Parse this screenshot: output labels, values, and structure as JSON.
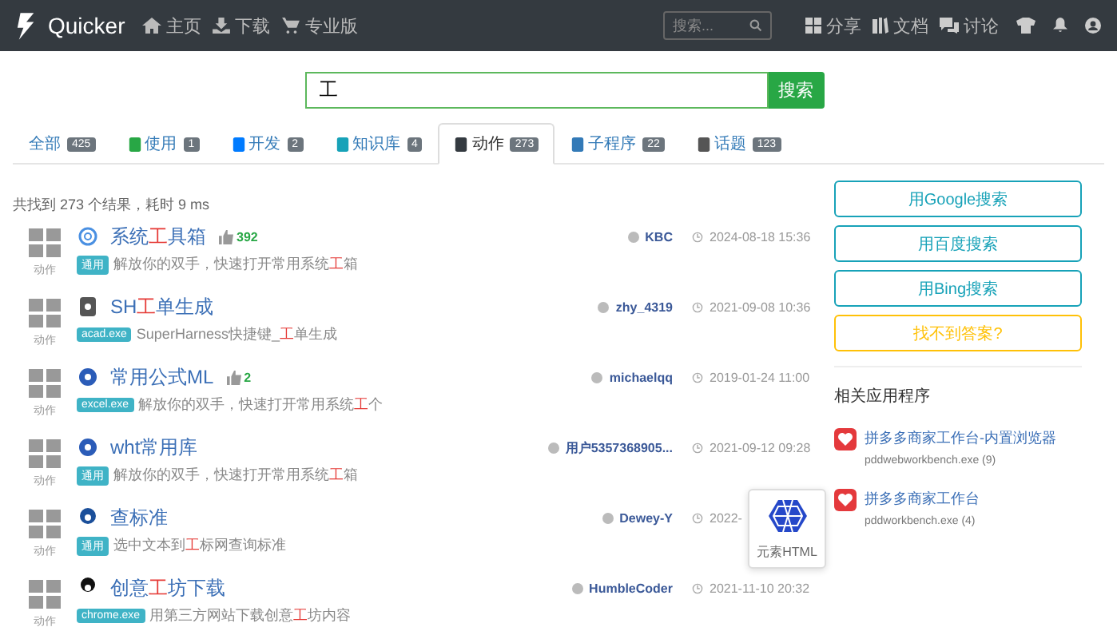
{
  "navbar": {
    "brand": "Quicker",
    "links": [
      {
        "label": "主页"
      },
      {
        "label": "下载"
      },
      {
        "label": "专业版"
      }
    ],
    "search": {
      "placeholder": "搜索..."
    },
    "right_links": [
      {
        "label": "分享"
      },
      {
        "label": "文档"
      },
      {
        "label": "讨论"
      }
    ]
  },
  "search": {
    "value": "工",
    "button": "搜索"
  },
  "tabs": [
    {
      "label": "全部",
      "count": "425",
      "selected": false
    },
    {
      "label": "使用",
      "count": "1",
      "selected": false
    },
    {
      "label": "开发",
      "count": "2",
      "selected": false
    },
    {
      "label": "知识库",
      "count": "4",
      "selected": false
    },
    {
      "label": "动作",
      "count": "273",
      "selected": true
    },
    {
      "label": "子程序",
      "count": "22",
      "selected": false
    },
    {
      "label": "话题",
      "count": "123",
      "selected": false
    }
  ],
  "summary": "共找到 273 个结果，耗时 9 ms",
  "results": [
    {
      "type": "动作",
      "title": [
        {
          "text": "系统",
          "highlight": false
        },
        {
          "text": "工",
          "highlight": true
        },
        {
          "text": "具箱",
          "highlight": false
        }
      ],
      "likes": "392",
      "tag": "通用",
      "desc": [
        {
          "text": "解放你的双手，快速打开常用系统",
          "highlight": false
        },
        {
          "text": "工",
          "highlight": true
        },
        {
          "text": "箱",
          "highlight": false
        }
      ],
      "author": "KBC",
      "date": "2024-08-18 15:36"
    },
    {
      "type": "动作",
      "title": [
        {
          "text": "SH",
          "highlight": false
        },
        {
          "text": "工",
          "highlight": true
        },
        {
          "text": "单生成",
          "highlight": false
        }
      ],
      "tag": "acad.exe",
      "desc": [
        {
          "text": "SuperHarness快捷键_",
          "highlight": false
        },
        {
          "text": "工",
          "highlight": true
        },
        {
          "text": "单生成",
          "highlight": false
        }
      ],
      "author": "zhy_4319",
      "date": "2021-09-08 10:36"
    },
    {
      "type": "动作",
      "title": [
        {
          "text": "常用公式ML",
          "highlight": false
        }
      ],
      "likes": "2",
      "tag": "excel.exe",
      "desc": [
        {
          "text": "解放你的双手，快速打开常用系统",
          "highlight": false
        },
        {
          "text": "工",
          "highlight": true
        },
        {
          "text": "个",
          "highlight": false
        }
      ],
      "author": "michaelqq",
      "date": "2019-01-24 11:00"
    },
    {
      "type": "动作",
      "title": [
        {
          "text": "wht常用库",
          "highlight": false
        }
      ],
      "tag": "通用",
      "desc": [
        {
          "text": "解放你的双手，快速打开常用系统",
          "highlight": false
        },
        {
          "text": "工",
          "highlight": true
        },
        {
          "text": "箱",
          "highlight": false
        }
      ],
      "author": "用户5357368905...",
      "date": "2021-09-12 09:28"
    },
    {
      "type": "动作",
      "title": [
        {
          "text": "查标准",
          "highlight": false
        }
      ],
      "tag": "通用",
      "desc": [
        {
          "text": "选中文本到",
          "highlight": false
        },
        {
          "text": "工",
          "highlight": true
        },
        {
          "text": "标网查询标准",
          "highlight": false
        }
      ],
      "author": "Dewey-Y",
      "date": "2022-"
    },
    {
      "type": "动作",
      "title": [
        {
          "text": "创意",
          "highlight": false
        },
        {
          "text": "工",
          "highlight": true
        },
        {
          "text": "坊下载",
          "highlight": false
        }
      ],
      "tag": "chrome.exe",
      "desc": [
        {
          "text": "用第三方网站下载创意",
          "highlight": false
        },
        {
          "text": "工",
          "highlight": true
        },
        {
          "text": "坊内容",
          "highlight": false
        }
      ],
      "author": "HumbleCoder",
      "date": "2021-11-10 20:32"
    }
  ],
  "popup": {
    "label": "元素HTML"
  },
  "side_buttons": [
    {
      "label": "用Google搜索",
      "kind": "search"
    },
    {
      "label": "用百度搜索",
      "kind": "search"
    },
    {
      "label": "用Bing搜索",
      "kind": "search"
    },
    {
      "label": "找不到答案?",
      "kind": "warning"
    }
  ],
  "related": {
    "heading": "相关应用程序",
    "apps": [
      {
        "name": "拼多多商家工作台-内置浏览器",
        "exe": "pddwebworkbench.exe (9)"
      },
      {
        "name": "拼多多商家工作台",
        "exe": "pddworkbench.exe (4)"
      }
    ]
  }
}
